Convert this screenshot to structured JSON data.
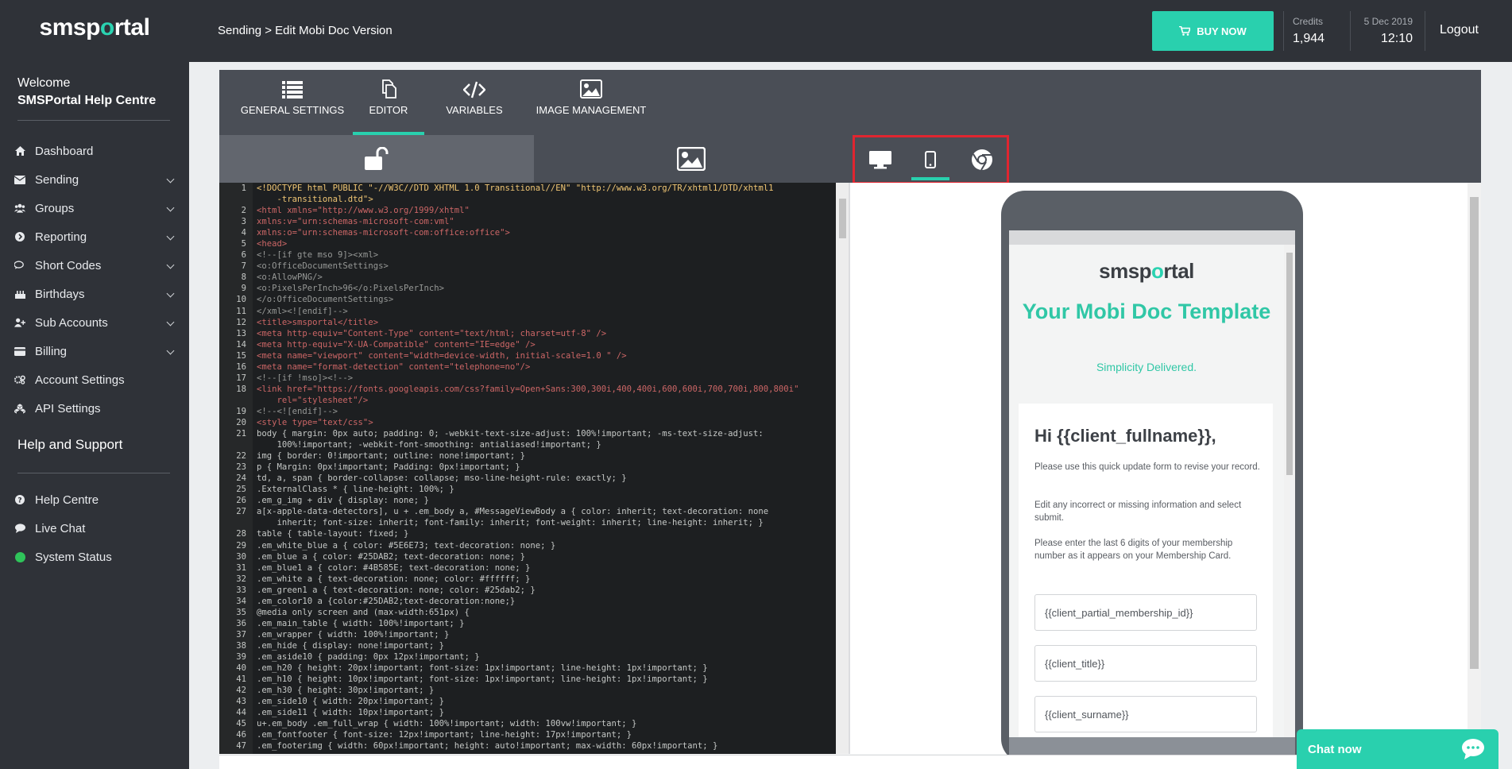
{
  "brand": {
    "name_start": "smsp",
    "name_dot": "o",
    "name_end": "rtal",
    "accent": "#29d0ae"
  },
  "sidebar": {
    "welcome": "Welcome",
    "company": "SMSPortal Help Centre",
    "items": [
      {
        "label": "Dashboard",
        "icon": "home-icon"
      },
      {
        "label": "Sending",
        "icon": "envelope-icon"
      },
      {
        "label": "Groups",
        "icon": "users-icon"
      },
      {
        "label": "Reporting",
        "icon": "circle-arrow-icon"
      },
      {
        "label": "Short Codes",
        "icon": "chat-bubbles-icon"
      },
      {
        "label": "Birthdays",
        "icon": "cake-icon"
      },
      {
        "label": "Sub Accounts",
        "icon": "user-plus-icon"
      },
      {
        "label": "Billing",
        "icon": "credit-card-icon"
      },
      {
        "label": "Account Settings",
        "icon": "gears-icon"
      },
      {
        "label": "API Settings",
        "icon": "cubes-icon"
      }
    ],
    "help_title": "Help and Support",
    "help_items": [
      {
        "label": "Help Centre",
        "icon": "question-circle-icon"
      },
      {
        "label": "Live Chat",
        "icon": "comment-icon"
      },
      {
        "label": "System Status",
        "icon": "status-dot-icon"
      }
    ]
  },
  "topbar": {
    "breadcrumb": "Sending > Edit Mobi Doc Version",
    "buy_now": "BUY NOW",
    "credits_label": "Credits",
    "credits_value": "1,944",
    "date": "5 Dec 2019",
    "time": "12:10",
    "logout": "Logout"
  },
  "tabs": [
    {
      "label": "GENERAL SETTINGS",
      "icon": "list-icon"
    },
    {
      "label": "EDITOR",
      "icon": "copy-icon",
      "active": true
    },
    {
      "label": "VARIABLES",
      "icon": "code-icon"
    },
    {
      "label": "IMAGE MANAGEMENT",
      "icon": "image-icon"
    }
  ],
  "code_lines": [
    {
      "n": "1",
      "t": "<!DOCTYPE html PUBLIC \"-//W3C//DTD XHTML 1.0 Transitional//EN\" \"http://www.w3.org/TR/xhtml1/DTD/xhtml1",
      "k": "st"
    },
    {
      "n": "",
      "t": "    -transitional.dtd\">",
      "k": "st"
    },
    {
      "n": "2",
      "t": "<html xmlns=\"http://www.w3.org/1999/xhtml\"",
      "k": "tag"
    },
    {
      "n": "3",
      "t": "xmlns:v=\"urn:schemas-microsoft-com:vml\"",
      "k": "tag"
    },
    {
      "n": "4",
      "t": "xmlns:o=\"urn:schemas-microsoft-com:office:office\">",
      "k": "tag"
    },
    {
      "n": "5",
      "t": "<head>",
      "k": "tag"
    },
    {
      "n": "6",
      "t": "<!--[if gte mso 9]><xml>",
      "k": "cm"
    },
    {
      "n": "7",
      "t": "<o:OfficeDocumentSettings>",
      "k": "cm"
    },
    {
      "n": "8",
      "t": "<o:AllowPNG/>",
      "k": "cm"
    },
    {
      "n": "9",
      "t": "<o:PixelsPerInch>96</o:PixelsPerInch>",
      "k": "cm"
    },
    {
      "n": "10",
      "t": "</o:OfficeDocumentSettings>",
      "k": "cm"
    },
    {
      "n": "11",
      "t": "</xml><![endif]-->",
      "k": "cm"
    },
    {
      "n": "12",
      "t": "<title>smsportal</title>",
      "k": "tag"
    },
    {
      "n": "13",
      "t": "<meta http-equiv=\"Content-Type\" content=\"text/html; charset=utf-8\" />",
      "k": "tag"
    },
    {
      "n": "14",
      "t": "<meta http-equiv=\"X-UA-Compatible\" content=\"IE=edge\" />",
      "k": "tag"
    },
    {
      "n": "15",
      "t": "<meta name=\"viewport\" content=\"width=device-width, initial-scale=1.0 \" />",
      "k": "tag"
    },
    {
      "n": "16",
      "t": "<meta name=\"format-detection\" content=\"telephone=no\"/>",
      "k": "tag"
    },
    {
      "n": "17",
      "t": "<!--[if !mso]><!-->",
      "k": "cm"
    },
    {
      "n": "18",
      "t": "<link href=\"https://fonts.googleapis.com/css?family=Open+Sans:300,300i,400,400i,600,600i,700,700i,800,800i\"",
      "k": "tag"
    },
    {
      "n": "",
      "t": "    rel=\"stylesheet\"/>",
      "k": "tag"
    },
    {
      "n": "19",
      "t": "<!--<![endif]-->",
      "k": "cm"
    },
    {
      "n": "20",
      "t": "<style type=\"text/css\">",
      "k": "tag"
    },
    {
      "n": "21",
      "t": "body { margin: 0px auto; padding: 0; -webkit-text-size-adjust: 100%!important; -ms-text-size-adjust:",
      "k": "plain"
    },
    {
      "n": "",
      "t": "    100%!important; -webkit-font-smoothing: antialiased!important; }",
      "k": "plain"
    },
    {
      "n": "22",
      "t": "img { border: 0!important; outline: none!important; }",
      "k": "plain"
    },
    {
      "n": "23",
      "t": "p { Margin: 0px!important; Padding: 0px!important; }",
      "k": "plain"
    },
    {
      "n": "24",
      "t": "td, a, span { border-collapse: collapse; mso-line-height-rule: exactly; }",
      "k": "plain"
    },
    {
      "n": "25",
      "t": ".ExternalClass * { line-height: 100%; }",
      "k": "plain"
    },
    {
      "n": "26",
      "t": ".em_g_img + div { display: none; }",
      "k": "plain"
    },
    {
      "n": "27",
      "t": "a[x-apple-data-detectors], u + .em_body a, #MessageViewBody a { color: inherit; text-decoration: none",
      "k": "plain"
    },
    {
      "n": "",
      "t": "    inherit; font-size: inherit; font-family: inherit; font-weight: inherit; line-height: inherit; }",
      "k": "plain"
    },
    {
      "n": "28",
      "t": "table { table-layout: fixed; }",
      "k": "plain"
    },
    {
      "n": "29",
      "t": ".em_white_blue a { color: #5E6E73; text-decoration: none; }",
      "k": "plain"
    },
    {
      "n": "30",
      "t": ".em_blue a { color: #25DAB2; text-decoration: none; }",
      "k": "plain"
    },
    {
      "n": "31",
      "t": ".em_blue1 a { color: #4B585E; text-decoration: none; }",
      "k": "plain"
    },
    {
      "n": "32",
      "t": ".em_white a { text-decoration: none; color: #ffffff; }",
      "k": "plain"
    },
    {
      "n": "33",
      "t": ".em_green1 a { text-decoration: none; color: #25dab2; }",
      "k": "plain"
    },
    {
      "n": "34",
      "t": ".em_color10 a {color:#25DAB2;text-decoration:none;}",
      "k": "plain"
    },
    {
      "n": "35",
      "t": "@media only screen and (max-width:651px) {",
      "k": "plain"
    },
    {
      "n": "36",
      "t": ".em_main_table { width: 100%!important; }",
      "k": "plain"
    },
    {
      "n": "37",
      "t": ".em_wrapper { width: 100%!important; }",
      "k": "plain"
    },
    {
      "n": "38",
      "t": ".em_hide { display: none!important; }",
      "k": "plain"
    },
    {
      "n": "39",
      "t": ".em_aside10 { padding: 0px 12px!important; }",
      "k": "plain"
    },
    {
      "n": "40",
      "t": ".em_h20 { height: 20px!important; font-size: 1px!important; line-height: 1px!important; }",
      "k": "plain"
    },
    {
      "n": "41",
      "t": ".em_h10 { height: 10px!important; font-size: 1px!important; line-height: 1px!important; }",
      "k": "plain"
    },
    {
      "n": "42",
      "t": ".em_h30 { height: 30px!important; }",
      "k": "plain"
    },
    {
      "n": "43",
      "t": ".em_side10 { width: 20px!important; }",
      "k": "plain"
    },
    {
      "n": "44",
      "t": ".em_side11 { width: 10px!important; }",
      "k": "plain"
    },
    {
      "n": "45",
      "t": "u+.em_body .em_full_wrap { width: 100%!important; width: 100vw!important; }",
      "k": "plain"
    },
    {
      "n": "46",
      "t": ".em_fontfooter { font-size: 12px!important; line-height: 17px!important; }",
      "k": "plain"
    },
    {
      "n": "47",
      "t": ".em_footerimg { width: 60px!important; height: auto!important; max-width: 60px!important; }",
      "k": "plain"
    }
  ],
  "preview": {
    "logo_start": "smsp",
    "logo_dot": "o",
    "logo_end": "rtal",
    "title": "Your Mobi Doc Template",
    "subtitle": "Simplicity Delivered.",
    "greeting": "Hi {{client_fullname}},",
    "paragraphs": [
      "Please use this quick update form to revise your record.",
      "Edit any incorrect or missing information and select submit.",
      "Please enter the last 6 digits of your membership number as it appears on your Membership Card."
    ],
    "fields": [
      "{{client_partial_membership_id}}",
      "{{client_title}}",
      "{{client_surname}}"
    ]
  },
  "chat": {
    "label": "Chat now"
  }
}
